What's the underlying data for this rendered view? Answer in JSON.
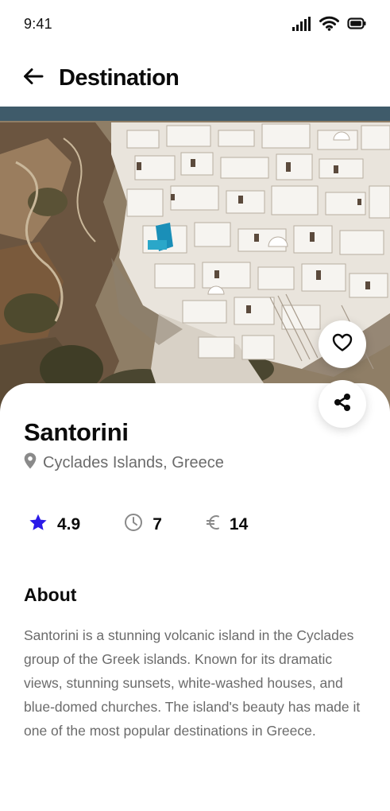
{
  "status_bar": {
    "time": "9:41",
    "icons": [
      "cellular-signal-icon",
      "wifi-icon",
      "battery-icon"
    ]
  },
  "header": {
    "back_icon": "arrow-left-icon",
    "title": "Destination"
  },
  "hero": {
    "image": "santorini-village-photo"
  },
  "actions": {
    "favorite_icon": "heart-icon",
    "share_icon": "share-icon"
  },
  "place": {
    "name": "Santorini",
    "location_icon": "map-pin-icon",
    "location": "Cyclades Islands, Greece"
  },
  "stats": {
    "rating": {
      "icon": "star-icon",
      "value": "4.9",
      "color": "#2b1ae8"
    },
    "duration": {
      "icon": "clock-icon",
      "value": "7"
    },
    "price": {
      "icon": "euro-icon",
      "value": "14"
    }
  },
  "about": {
    "title": "About",
    "text": "Santorini is a stunning volcanic island in the Cyclades group of the Greek islands. Known for its dramatic views, stunning sunsets, white-washed houses, and blue-domed churches. The island's beauty has made it one of the most popular destinations in Greece."
  },
  "colors": {
    "accent": "#2b1ae8",
    "text_primary": "#0b0b0b",
    "text_secondary": "#6b6b6b",
    "background": "#ffffff"
  }
}
